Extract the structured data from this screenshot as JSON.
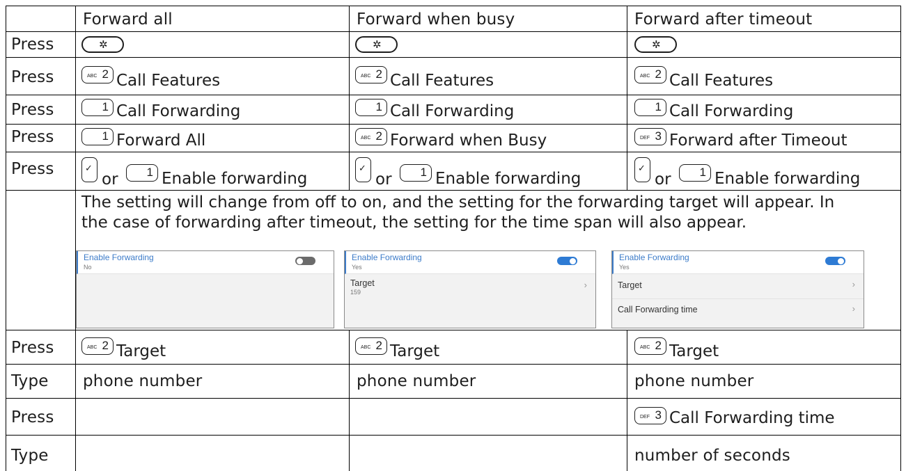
{
  "columns": {
    "all": "Forward all",
    "busy": "Forward when busy",
    "timeout": "Forward after timeout"
  },
  "row_labels": {
    "r1": "Press",
    "r2": "Press",
    "r3": "Press",
    "r4": "Press",
    "r5": "Press",
    "r7": "Press",
    "r8": "Type",
    "r9": "Press",
    "r10": "Type"
  },
  "keys": {
    "menu_icon": "gear-icon",
    "ok_icon": "check-icon",
    "one": "1",
    "two": "2",
    "two_sub": "ABC",
    "three": "3",
    "three_sub": "DEF"
  },
  "steps": {
    "call_features": "Call Features",
    "call_forwarding": "Call Forwarding",
    "forward_all": "Forward All",
    "forward_busy": "Forward when Busy",
    "forward_timeout": "Forward after Timeout",
    "or": "or",
    "enable_forwarding": "Enable forwarding",
    "target": "Target",
    "phone_number": "phone number",
    "call_forwarding_time": "Call Forwarding time",
    "number_of_seconds": "number of seconds"
  },
  "description": {
    "line1": "The setting will change from off to on, and the setting for the forwarding target will appear.  In",
    "line2": "the case of forwarding after timeout, the setting for the time span will also appear."
  },
  "screens": {
    "all": {
      "title": "Enable Forwarding",
      "value": "No",
      "toggle_on": false
    },
    "busy": {
      "title": "Enable Forwarding",
      "value": "Yes",
      "toggle_on": true,
      "target_label": "Target",
      "target_value": "159"
    },
    "timeout": {
      "title": "Enable Forwarding",
      "value": "Yes",
      "toggle_on": true,
      "target_label": "Target",
      "time_label": "Call Forwarding time"
    }
  },
  "colors": {
    "accent": "#3d7cc9",
    "toggle_on": "#2e7bd4",
    "toggle_off": "#6b6b6b",
    "border": "#000000"
  }
}
